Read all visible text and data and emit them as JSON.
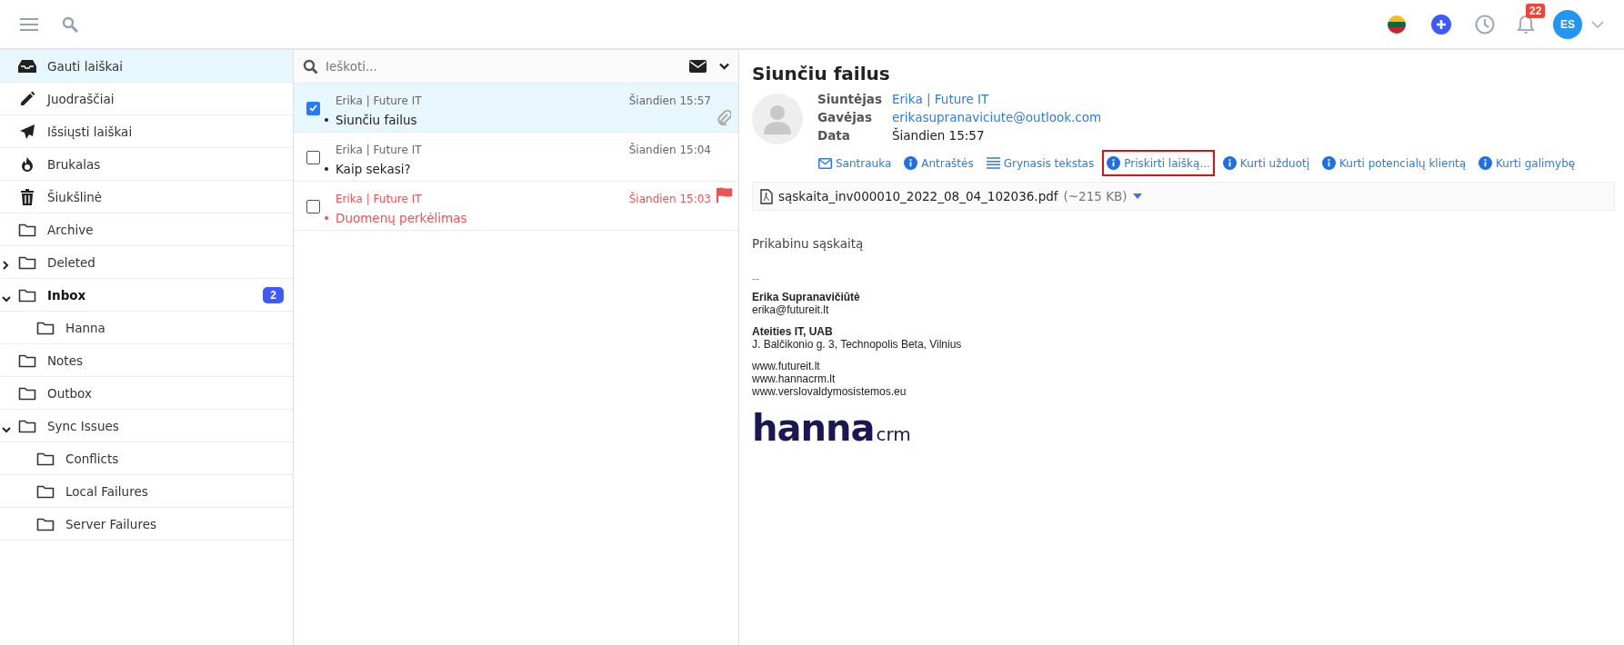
{
  "topbar": {
    "notifications": "22",
    "avatar": "ES"
  },
  "sidebar": {
    "items": [
      {
        "label": "Gauti laiškai",
        "kind": "inbox",
        "selected": true
      },
      {
        "label": "Juodraščiai",
        "kind": "drafts",
        "selected": false
      },
      {
        "label": "Išsiųsti laiškai",
        "kind": "sent",
        "selected": false
      },
      {
        "label": "Brukalas",
        "kind": "spam",
        "selected": false
      },
      {
        "label": "Šiukšlinė",
        "kind": "trash",
        "selected": false
      },
      {
        "label": "Archive",
        "kind": "folder",
        "selected": false
      },
      {
        "label": "Deleted",
        "kind": "folder",
        "selected": false,
        "expanded": false
      },
      {
        "label": "Inbox",
        "kind": "folder",
        "selected": false,
        "expanded": true,
        "bold": true,
        "badge": "2",
        "children": [
          {
            "label": "Hanna",
            "kind": "folder",
            "selected": false
          }
        ]
      },
      {
        "label": "Notes",
        "kind": "folder",
        "selected": false
      },
      {
        "label": "Outbox",
        "kind": "folder",
        "selected": false
      },
      {
        "label": "Sync Issues",
        "kind": "folder",
        "selected": false,
        "expanded": true,
        "children": [
          {
            "label": "Conflicts",
            "kind": "folder",
            "selected": false
          },
          {
            "label": "Local Failures",
            "kind": "folder",
            "selected": false
          },
          {
            "label": "Server Failures",
            "kind": "folder",
            "selected": false
          }
        ]
      }
    ]
  },
  "message_list": {
    "search": {
      "placeholder": "Ieškoti..."
    },
    "messages": [
      {
        "sender": "Erika | Future IT",
        "time": "Šiandien 15:57",
        "subject": "Siunčiu failus",
        "selected": true,
        "checked": true,
        "flagged": false,
        "attachment": true
      },
      {
        "sender": "Erika | Future IT",
        "time": "Šiandien 15:04",
        "subject": "Kaip sekasi?",
        "selected": false,
        "checked": false,
        "flagged": false,
        "attachment": false
      },
      {
        "sender": "Erika | Future IT",
        "time": "Šiandien 15:03",
        "subject": "Duomenų perkėlimas",
        "selected": false,
        "checked": false,
        "flagged": true,
        "attachment": false
      }
    ]
  },
  "reader": {
    "subject": "Siunčiu failus",
    "fields": [
      {
        "label": "Siuntėjas",
        "value": "Erika | Future IT",
        "link": true
      },
      {
        "label": "Gavėjas",
        "value": "erikasupranaviciute@outlook.com",
        "link": true
      },
      {
        "label": "Data",
        "value": "Šiandien 15:57",
        "link": false
      }
    ],
    "actions": [
      {
        "label": "Santrauka",
        "kind": "envelope",
        "highlighted": false
      },
      {
        "label": "Antraštės",
        "kind": "info",
        "highlighted": false
      },
      {
        "label": "Grynasis tekstas",
        "kind": "lines",
        "highlighted": false
      },
      {
        "label": "Priskirti laišką...",
        "kind": "info",
        "highlighted": true
      },
      {
        "label": "Kurti užduotį",
        "kind": "info",
        "highlighted": false
      },
      {
        "label": "Kurti potencialų klientą",
        "kind": "info",
        "highlighted": false
      },
      {
        "label": "Kurti galimybę",
        "kind": "info",
        "highlighted": false
      }
    ],
    "attachment": {
      "name": "sąskaita_inv000010_2022_08_04_102036.pdf",
      "size": "(~215 KB)"
    },
    "body": "Prikabinu sąskaitą",
    "signature": {
      "separator": "--",
      "blocks": [
        [
          "**Erika Supranavičiūtė**",
          "erika@futureit.lt"
        ],
        [
          "**Ateities IT, UAB**",
          "J. Balčikonio g. 3, Technopolis Beta, Vilnius"
        ],
        [
          "www.futureit.lt",
          "www.hannacrm.lt",
          "www.verslovaldymosistemos.eu"
        ]
      ],
      "logo": {
        "word": "hanna",
        "suffix": "crm"
      }
    }
  }
}
